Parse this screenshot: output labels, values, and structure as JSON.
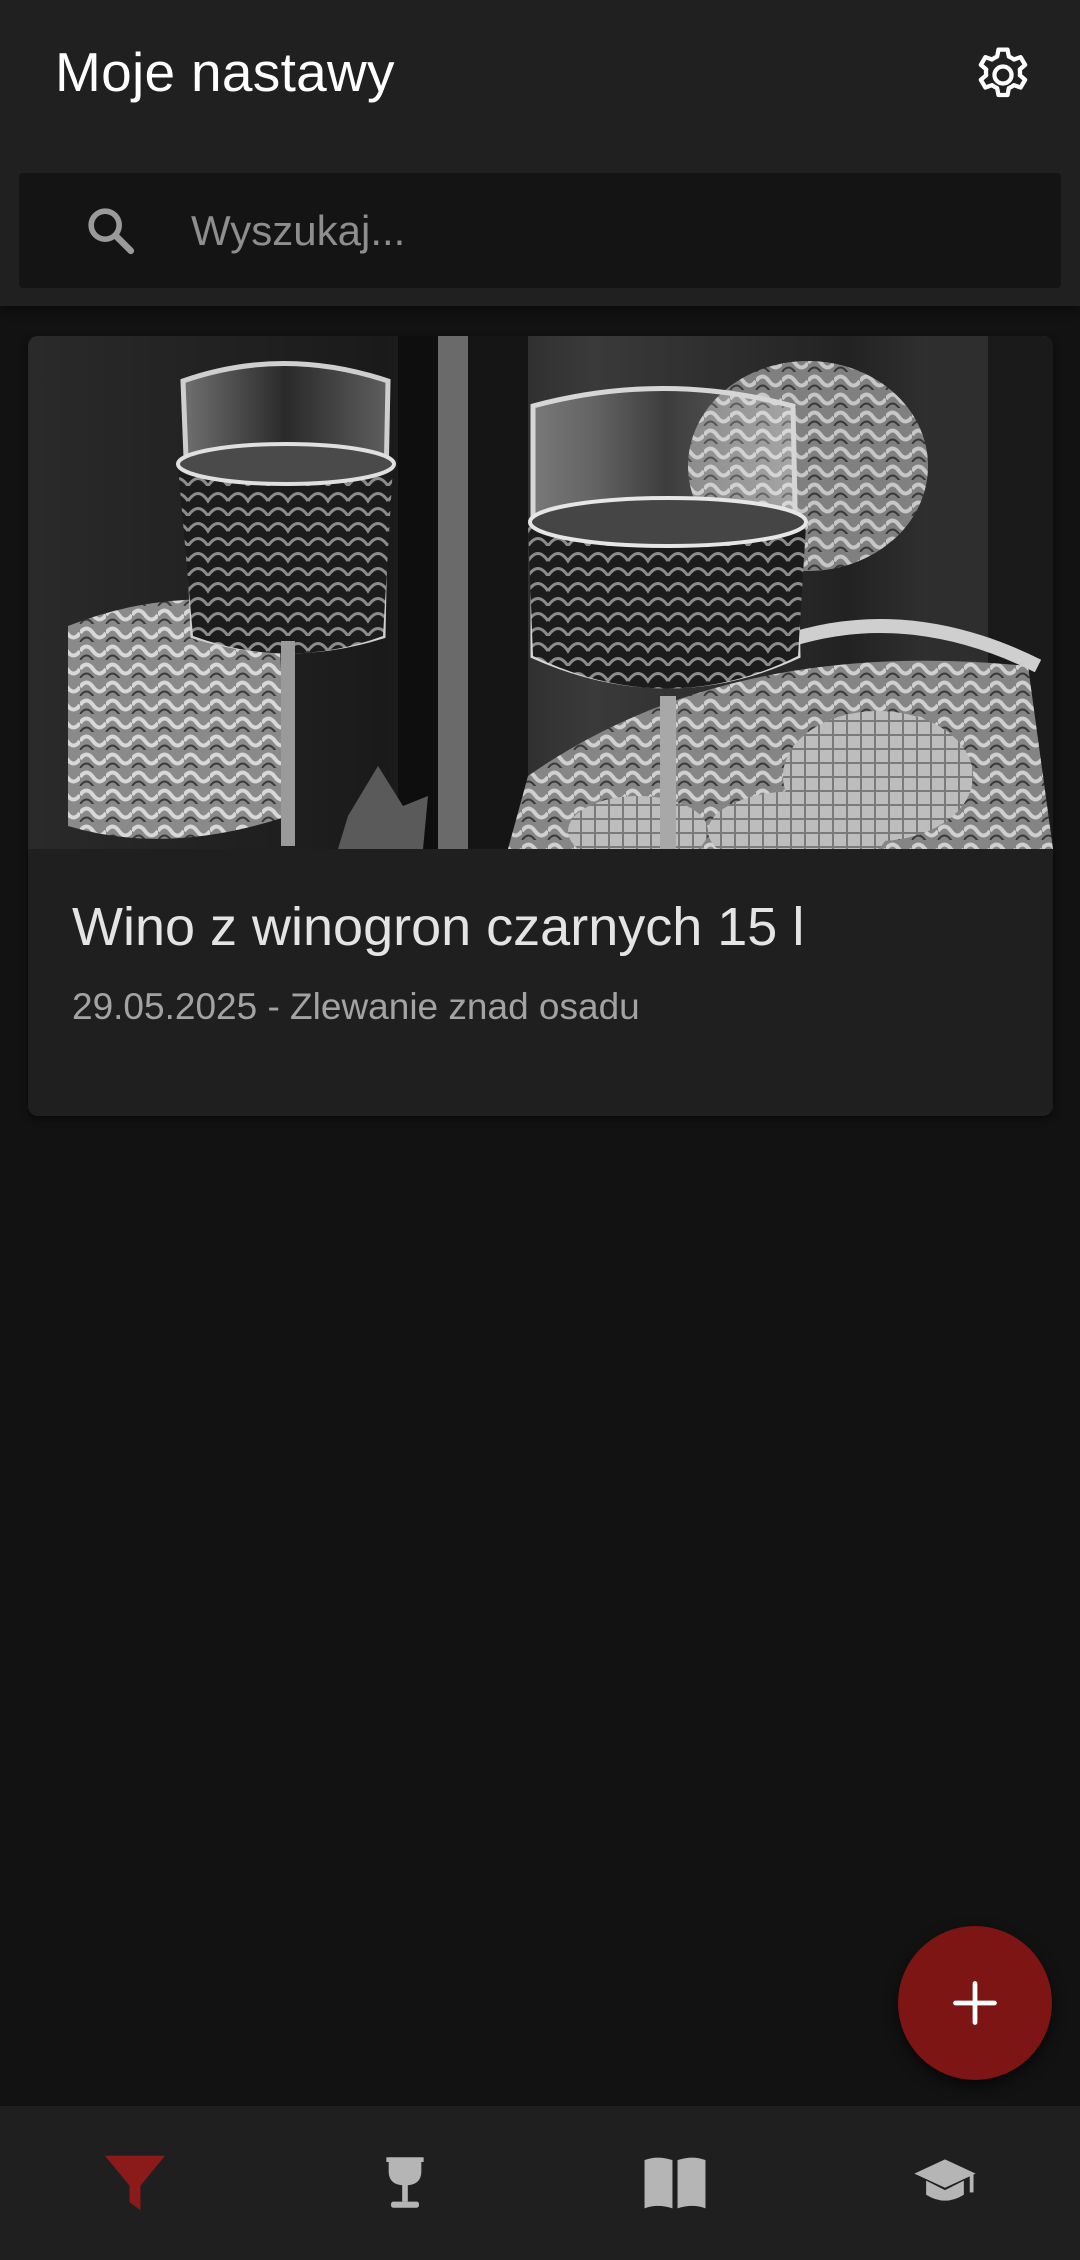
{
  "header": {
    "title": "Moje nastawy",
    "settings_icon": "gear-icon"
  },
  "search": {
    "placeholder": "Wyszukaj...",
    "value": "",
    "icon": "search-icon"
  },
  "batches": [
    {
      "title": "Wino z winogron czarnych 15 l",
      "subtitle": "29.05.2025 - Zlewanie znad osadu",
      "image": "wine-glasses-photo"
    }
  ],
  "fab": {
    "icon": "plus-icon"
  },
  "bottom_nav": {
    "items": [
      {
        "icon": "funnel-icon",
        "active": true
      },
      {
        "icon": "wine-glass-icon",
        "active": false
      },
      {
        "icon": "book-icon",
        "active": false
      },
      {
        "icon": "graduation-cap-icon",
        "active": false
      }
    ]
  },
  "colors": {
    "accent": "#7d1515",
    "active_nav": "#8b1a1a",
    "inactive_nav": "#b5b5b5",
    "app_bar": "#202020",
    "background": "#121212",
    "card": "#1f1f1f"
  }
}
